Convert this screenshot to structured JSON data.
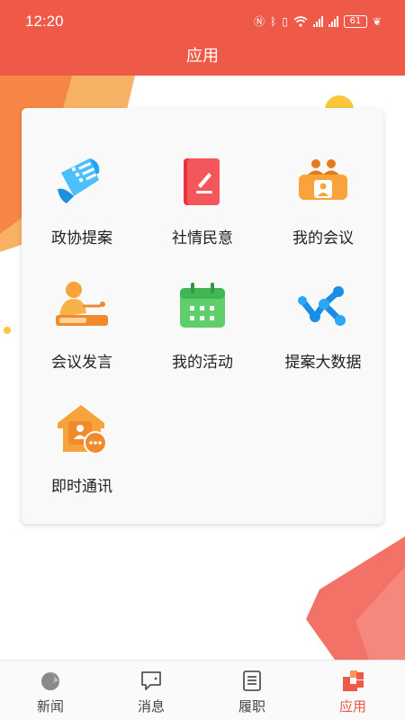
{
  "status_bar": {
    "time": "12:20",
    "battery": "61",
    "icons": [
      "nfc-icon",
      "bluetooth-icon",
      "vibrate-icon",
      "wifi-icon",
      "signal-icon",
      "signal-icon",
      "battery-icon",
      "leaf-icon"
    ]
  },
  "header": {
    "title": "应用"
  },
  "apps": [
    {
      "label": "政协提案",
      "icon": "proposal-document-icon"
    },
    {
      "label": "社情民意",
      "icon": "public-opinion-note-icon"
    },
    {
      "label": "我的会议",
      "icon": "meeting-icon"
    },
    {
      "label": "会议发言",
      "icon": "speech-podium-icon"
    },
    {
      "label": "我的活动",
      "icon": "calendar-icon"
    },
    {
      "label": "提案大数据",
      "icon": "big-data-network-icon"
    },
    {
      "label": "即时通讯",
      "icon": "instant-messaging-icon"
    }
  ],
  "bottom_nav": [
    {
      "label": "新闻",
      "icon": "news-icon",
      "active": false
    },
    {
      "label": "消息",
      "icon": "message-icon",
      "active": false
    },
    {
      "label": "履职",
      "icon": "duty-list-icon",
      "active": false
    },
    {
      "label": "应用",
      "icon": "apps-icon",
      "active": true
    }
  ],
  "colors": {
    "primary": "#ee5a47",
    "background": "#ffffff",
    "card": "#f9f9f9",
    "nav_active": "#ee5a47"
  }
}
